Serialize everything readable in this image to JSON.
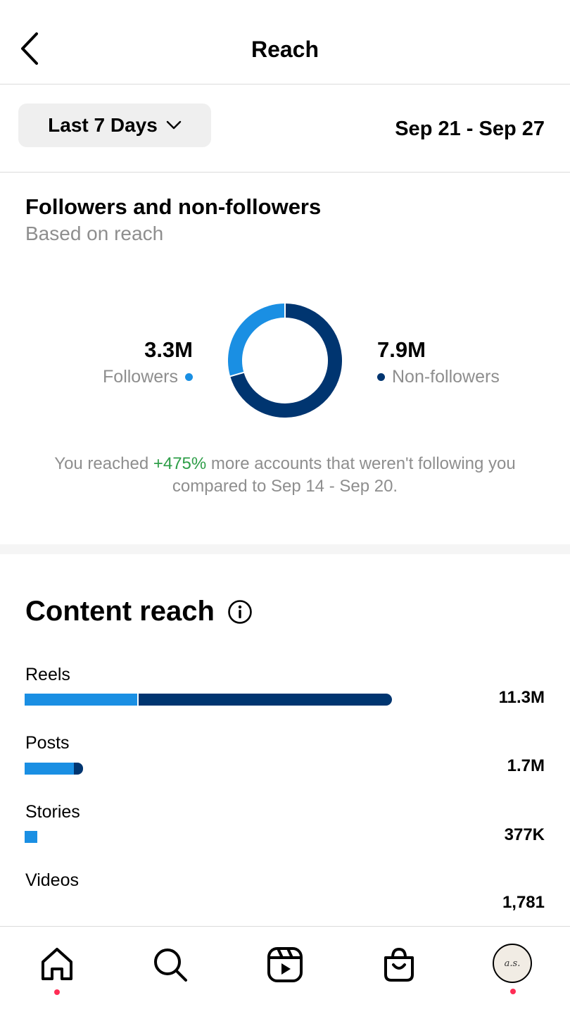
{
  "header": {
    "title": "Reach",
    "back_icon": "chevron-left-icon"
  },
  "range": {
    "selector_label": "Last 7 Days",
    "date_range": "Sep 21 - Sep 27"
  },
  "followers_section": {
    "title": "Followers and non-followers",
    "subtitle": "Based on reach",
    "followers_value": "3.3M",
    "followers_label": "Followers",
    "non_followers_value": "7.9M",
    "non_followers_label": "Non-followers",
    "compare_prefix": "You reached ",
    "compare_pct": "+475%",
    "compare_suffix": " more accounts that weren't following you compared to Sep 14 - Sep 20."
  },
  "content_reach": {
    "title": "Content reach",
    "rows": [
      {
        "label": "Reels",
        "value": "11.3M"
      },
      {
        "label": "Posts",
        "value": "1.7M"
      },
      {
        "label": "Stories",
        "value": "377K"
      },
      {
        "label": "Videos",
        "value": "1,781"
      }
    ]
  },
  "chart_data": {
    "type": "pie",
    "labels": [
      "Followers",
      "Non-followers"
    ],
    "values": [
      3.3,
      7.9
    ],
    "units": "M"
  },
  "tabbar": {
    "items": [
      "home-icon",
      "search-icon",
      "reels-icon",
      "shop-icon",
      "profile-avatar"
    ],
    "avatar_text": "a.s."
  },
  "colors": {
    "followers": "#1a8fe3",
    "non_followers": "#003570",
    "positive": "#2e9e48",
    "notification_dot": "#ff2d55"
  }
}
